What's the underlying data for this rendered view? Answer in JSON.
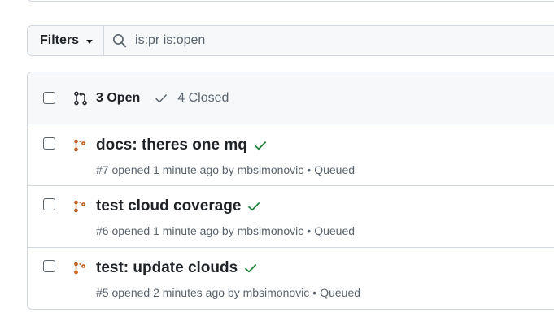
{
  "filters": {
    "label": "Filters",
    "search_value": "is:pr is:open"
  },
  "list": {
    "open_label": "3 Open",
    "closed_label": "4 Closed",
    "items": [
      {
        "title": "docs: theres one mq",
        "number": "#7",
        "opened": "opened 1 minute ago by",
        "author": "mbsimonovic",
        "status": "Queued"
      },
      {
        "title": "test cloud coverage",
        "number": "#6",
        "opened": "opened 1 minute ago by",
        "author": "mbsimonovic",
        "status": "Queued"
      },
      {
        "title": "test: update clouds",
        "number": "#5",
        "opened": "opened 2 minutes ago by",
        "author": "mbsimonovic",
        "status": "Queued"
      }
    ]
  },
  "colors": {
    "draft_icon": "#bc4c00",
    "check_success": "#1a7f37",
    "border": "#d0d7de",
    "header_bg": "#f6f8fa"
  },
  "icons": {
    "search": "search-icon",
    "pr_open": "git-pull-request-icon",
    "closed": "check-icon",
    "pr_row": "git-pull-request-draft-icon",
    "ci": "check-icon"
  }
}
